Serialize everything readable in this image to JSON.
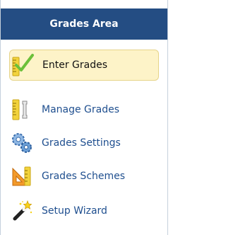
{
  "header": {
    "title": "Grades Area"
  },
  "menu": {
    "items": [
      {
        "label": "Enter Grades",
        "icon": "ruler-check-icon",
        "active": true
      },
      {
        "label": "Manage Grades",
        "icon": "ruler-tool-icon",
        "active": false
      },
      {
        "label": "Grades Settings",
        "icon": "gears-icon",
        "active": false
      },
      {
        "label": "Grades Schemes",
        "icon": "triangle-ruler-icon",
        "active": false
      },
      {
        "label": "Setup Wizard",
        "icon": "magic-wand-icon",
        "active": false
      }
    ]
  },
  "colors": {
    "header_bg": "#244d83",
    "active_bg": "#fdf3c8",
    "link": "#1f4f8f"
  }
}
